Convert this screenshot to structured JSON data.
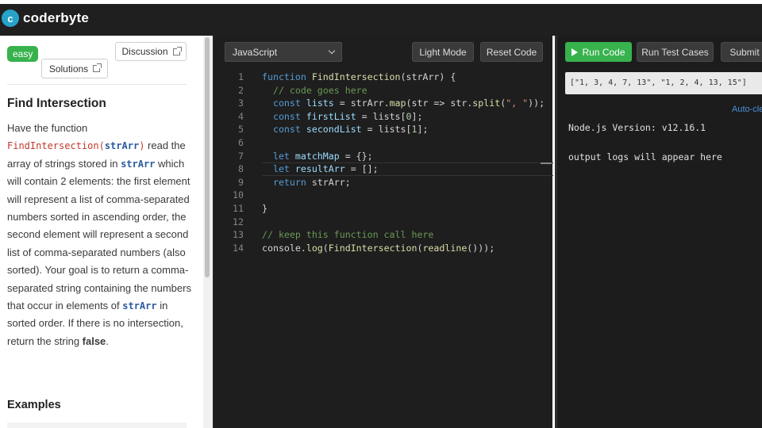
{
  "header": {
    "logo_mark": "c",
    "logo_text": "coderbyte"
  },
  "problem": {
    "difficulty": "easy",
    "discussion_label": "Discussion",
    "solutions_label": "Solutions",
    "title": "Find Intersection",
    "desc_1": "Have the function ",
    "func_name": "FindIntersection(",
    "func_arg": "strArr",
    "func_close": ")",
    "desc_2": " read the array of strings stored in ",
    "var_1": "strArr",
    "desc_3": " which will contain 2 elements: the first element will represent a list of comma-separated numbers sorted in ascending order, the second element will represent a second list of comma-separated numbers (also sorted). Your goal is to return a comma-separated string containing the numbers that occur in elements of ",
    "var_2": "strArr",
    "desc_4": " in sorted order. If there is no intersection, return the string ",
    "false_word": "false",
    "desc_5": ".",
    "examples_heading": "Examples"
  },
  "editor": {
    "language": "JavaScript",
    "light_mode_label": "Light Mode",
    "reset_label": "Reset Code",
    "line_numbers": [
      "1",
      "2",
      "3",
      "4",
      "5",
      "6",
      "7",
      "8",
      "9",
      "10",
      "11",
      "12",
      "13",
      "14"
    ],
    "code": {
      "l1_kw": "function ",
      "l1_fn": "FindIntersection",
      "l1_rest": "(strArr) {",
      "l2_cm": "// code goes here",
      "l3_kw": "const ",
      "l3_var": "lists",
      "l3_a": " = strArr.",
      "l3_fn": "map",
      "l3_b": "(str => str.",
      "l3_fn2": "split",
      "l3_c": "(",
      "l3_str": "\", \"",
      "l3_d": "));",
      "l4_kw": "const ",
      "l4_var": "firstList",
      "l4_a": " = lists[",
      "l4_num": "0",
      "l4_b": "];",
      "l5_kw": "const ",
      "l5_var": "secondList",
      "l5_a": " = lists[",
      "l5_num": "1",
      "l5_b": "];",
      "l7_kw": "let ",
      "l7_var": "matchMap",
      "l7_a": " = {};",
      "l8_kw": "let ",
      "l8_var": "resultArr",
      "l8_a": " = [];",
      "l9_kw": "return ",
      "l9_a": "strArr;",
      "l11": "}",
      "l13_cm": "// keep this function call here",
      "l14_a": "console.",
      "l14_fn": "log",
      "l14_b": "(",
      "l14_fn2": "FindIntersection",
      "l14_c": "(",
      "l14_fn3": "readline",
      "l14_d": "()));"
    }
  },
  "output": {
    "run_label": "Run Code",
    "tests_label": "Run Test Cases",
    "submit_label": "Submit",
    "input_value": "[\"1, 3, 4, 7, 13\", \"1, 2, 4, 13, 15\"]",
    "autoclear_label": "Auto-cle",
    "node_version": "Node.js Version: v12.16.1",
    "logs_placeholder": "output logs will appear here"
  },
  "colors": {
    "accent_green": "#37b24d",
    "editor_bg": "#1e1e1e",
    "brand_blue": "#27a2c9"
  }
}
